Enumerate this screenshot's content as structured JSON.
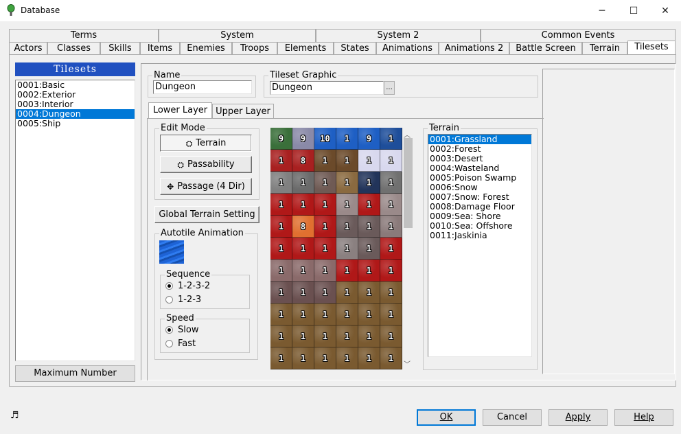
{
  "window": {
    "title": "Database",
    "minimize": "─",
    "maximize": "☐",
    "close": "✕"
  },
  "tabs_row1": [
    {
      "label": "Terms"
    },
    {
      "label": "System"
    },
    {
      "label": "System 2"
    },
    {
      "label": "Common Events"
    }
  ],
  "tabs_row2": [
    {
      "label": "Actors"
    },
    {
      "label": "Classes"
    },
    {
      "label": "Skills"
    },
    {
      "label": "Items"
    },
    {
      "label": "Enemies"
    },
    {
      "label": "Troops"
    },
    {
      "label": "Elements"
    },
    {
      "label": "States"
    },
    {
      "label": "Animations"
    },
    {
      "label": "Animations 2"
    },
    {
      "label": "Battle Screen"
    },
    {
      "label": "Terrain"
    },
    {
      "label": "Tilesets"
    }
  ],
  "tilesets_panel": {
    "header": "Tilesets",
    "items": [
      "0001:Basic",
      "0002:Exterior",
      "0003:Interior",
      "0004:Dungeon",
      "0005:Ship"
    ],
    "selected_index": 3,
    "max_button": "Maximum Number"
  },
  "name": {
    "label": "Name",
    "value": "Dungeon"
  },
  "tileset_graphic": {
    "label": "Tileset Graphic",
    "value": "Dungeon",
    "browse": "..."
  },
  "layer_tabs": {
    "lower": "Lower Layer",
    "upper": "Upper Layer"
  },
  "edit_mode": {
    "label": "Edit Mode",
    "terrain": "Terrain",
    "passability": "Passability",
    "passage": "Passage (4 Dir)"
  },
  "global_terrain": "Global Terrain Setting",
  "autotile": {
    "label": "Autotile Animation",
    "sequence_label": "Sequence",
    "seq_opt1": "1-2-3-2",
    "seq_opt2": "1-2-3",
    "speed_label": "Speed",
    "speed_opt1": "Slow",
    "speed_opt2": "Fast"
  },
  "terrain": {
    "label": "Terrain",
    "items": [
      "0001:Grassland",
      "0002:Forest",
      "0003:Desert",
      "0004:Wasteland",
      "0005:Poison Swamp",
      "0006:Snow",
      "0007:Snow: Forest",
      "0008:Damage Floor",
      "0009:Sea: Shore",
      "0010:Sea: Offshore",
      "0011:Jaskinia"
    ],
    "selected_index": 0
  },
  "tiles": [
    [
      "9",
      "9",
      "10",
      "1",
      "9",
      "1"
    ],
    [
      "1",
      "8",
      "1",
      "1",
      "1",
      "1"
    ],
    [
      "1",
      "1",
      "1",
      "1",
      "1",
      "1"
    ],
    [
      "1",
      "1",
      "1",
      "1",
      "1",
      "1"
    ],
    [
      "1",
      "8",
      "1",
      "1",
      "1",
      "1"
    ],
    [
      "1",
      "1",
      "1",
      "1",
      "1",
      "1"
    ],
    [
      "1",
      "1",
      "1",
      "1",
      "1",
      "1"
    ],
    [
      "1",
      "1",
      "1",
      "1",
      "1",
      "1"
    ],
    [
      "1",
      "1",
      "1",
      "1",
      "1",
      "1"
    ],
    [
      "1",
      "1",
      "1",
      "1",
      "1",
      "1"
    ],
    [
      "1",
      "1",
      "1",
      "1",
      "1",
      "1"
    ]
  ],
  "tile_colors": [
    [
      "#3a6f3a",
      "#8a8aa8",
      "#1e5fc4",
      "#1e5fc4",
      "#1e5fc4",
      "#1e4e9a"
    ],
    [
      "#a82020",
      "#a82020",
      "#6b4a2a",
      "#6b4a2a",
      "#d8d8ee",
      "#d8d8ee"
    ],
    [
      "#808080",
      "#6a6a6a",
      "#6f5a54",
      "#8a6a40",
      "#22345a",
      "#707070"
    ],
    [
      "#b01818",
      "#b01818",
      "#b01818",
      "#9a8a8a",
      "#b01818",
      "#9a8a8a"
    ],
    [
      "#b01818",
      "#e07030",
      "#b01818",
      "#6a5a5a",
      "#6a5a5a",
      "#8a7a7a"
    ],
    [
      "#b01818",
      "#b01818",
      "#b01818",
      "#8a8080",
      "#6a5a5a",
      "#b01818"
    ],
    [
      "#8a6a6a",
      "#8a6a6a",
      "#8a6a6a",
      "#b01818",
      "#b01818",
      "#b01818"
    ],
    [
      "#6a5050",
      "#6a5050",
      "#6a5050",
      "#7a5a30",
      "#7a5a30",
      "#7a5a30"
    ],
    [
      "#7a5a30",
      "#7a5a30",
      "#7a5a30",
      "#7a5a30",
      "#7a5a30",
      "#7a5a30"
    ],
    [
      "#7a5a30",
      "#7a5a30",
      "#7a5a30",
      "#7a5a30",
      "#7a5a30",
      "#7a5a30"
    ],
    [
      "#7a5a30",
      "#7a5a30",
      "#7a5a30",
      "#7a5a30",
      "#7a5a30",
      "#7a5a30"
    ]
  ],
  "buttons": {
    "ok": "OK",
    "cancel": "Cancel",
    "apply": "Apply",
    "help": "Help"
  },
  "status_icon": "music-note-icon"
}
